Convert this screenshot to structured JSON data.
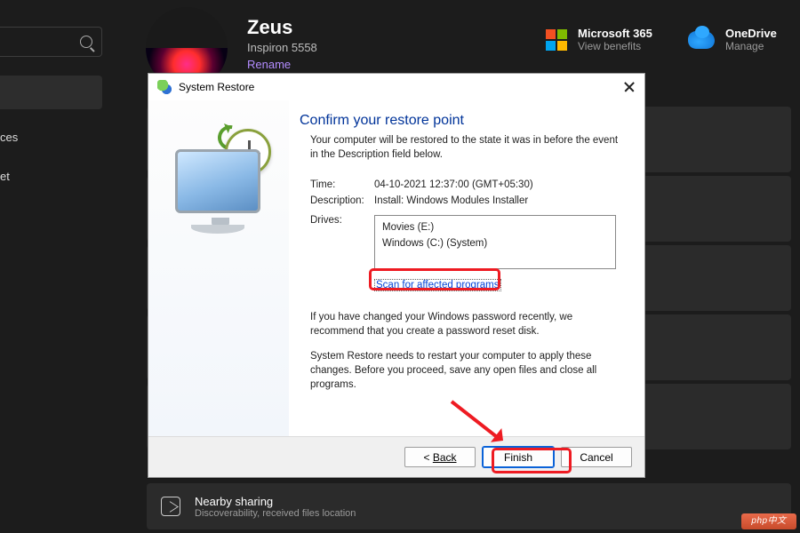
{
  "bg": {
    "nav": {
      "item_bt": "ces",
      "item_net": "et"
    },
    "profile": {
      "name": "Zeus",
      "model": "Inspiron 5558",
      "rename": "Rename"
    },
    "m365": {
      "title": "Microsoft 365",
      "sub": "View benefits"
    },
    "onedrive": {
      "title": "OneDrive",
      "sub": "Manage"
    },
    "nearby": {
      "title": "Nearby sharing",
      "sub": "Discoverability, received files location"
    },
    "watermark": "php中文"
  },
  "dialog": {
    "title": "System Restore",
    "heading": "Confirm your restore point",
    "sub": "Your computer will be restored to the state it was in before the event in the Description field below.",
    "time_k": "Time:",
    "time_v": "04-10-2021 12:37:00 (GMT+05:30)",
    "desc_k": "Description:",
    "desc_v": "Install: Windows Modules Installer",
    "drives_k": "Drives:",
    "drives": {
      "d1": "Movies (E:)",
      "d2": "Windows (C:) (System)"
    },
    "scan_link": "Scan for affected programs",
    "para1": "If you have changed your Windows password recently, we recommend that you create a password reset disk.",
    "para2": "System Restore needs to restart your computer to apply these changes. Before you proceed, save any open files and close all programs.",
    "buttons": {
      "back": "Back",
      "finish": "Finish",
      "cancel": "Cancel"
    }
  }
}
